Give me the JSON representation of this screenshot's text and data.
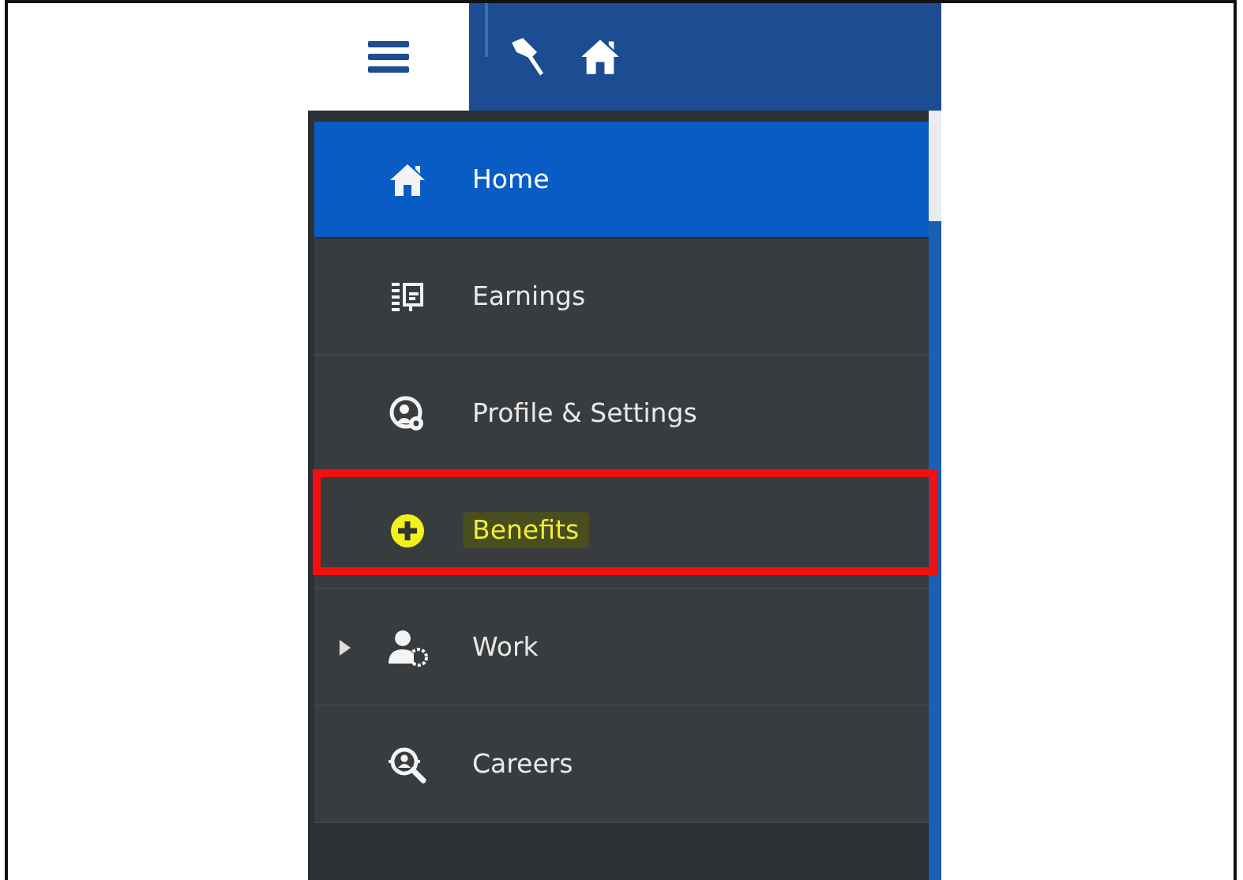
{
  "top_bar": {
    "menu_button": {
      "selected": true
    }
  },
  "menu": {
    "items": [
      {
        "label": "Home",
        "selected": true,
        "highlighted": false,
        "outlined": false,
        "caret": false
      },
      {
        "label": "Earnings",
        "selected": false,
        "highlighted": false,
        "outlined": false,
        "caret": false
      },
      {
        "label": "Profile & Settings",
        "selected": false,
        "highlighted": false,
        "outlined": false,
        "caret": false
      },
      {
        "label": "Benefits",
        "selected": false,
        "highlighted": true,
        "outlined": true,
        "caret": false
      },
      {
        "label": "Work",
        "selected": false,
        "highlighted": false,
        "outlined": false,
        "caret": true
      },
      {
        "label": "Careers",
        "selected": false,
        "highlighted": false,
        "outlined": false,
        "caret": false
      }
    ]
  }
}
